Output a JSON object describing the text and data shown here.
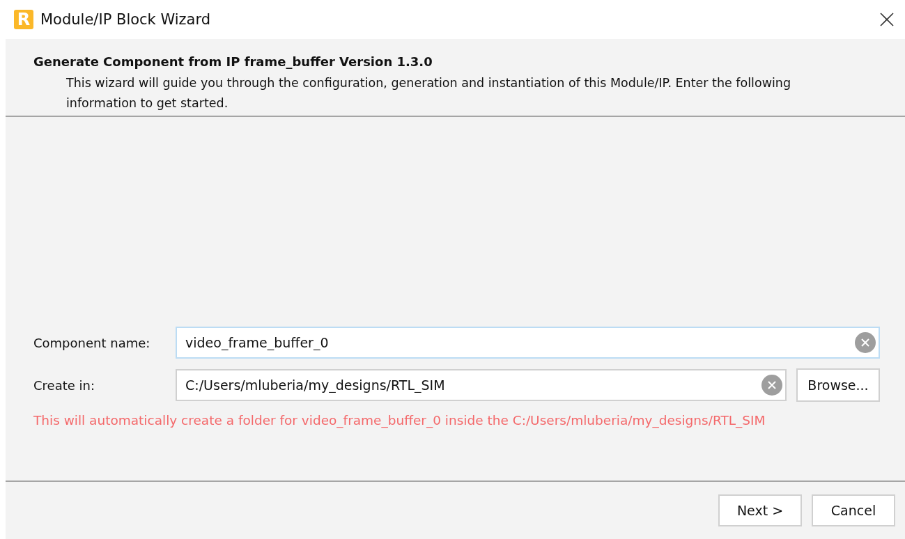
{
  "window": {
    "logo_letter": "R",
    "title": "Module/IP Block Wizard"
  },
  "header": {
    "title": "Generate Component from IP frame_buffer Version 1.3.0",
    "description": "This wizard will guide you through the configuration, generation and instantiation of this Module/IP. Enter the following information to get started."
  },
  "fields": [
    {
      "label": "Component name:",
      "value": "video_frame_buffer_0",
      "focused": true
    },
    {
      "label": "Create in:",
      "value": "C:/Users/mluberia/my_designs/RTL_SIM",
      "focused": false,
      "button": "Browse..."
    }
  ],
  "message": "This will automatically create a folder for video_frame_buffer_0 inside the C:/Users/mluberia/my_designs/RTL_SIM",
  "buttons": [
    "Next >",
    "Cancel"
  ]
}
